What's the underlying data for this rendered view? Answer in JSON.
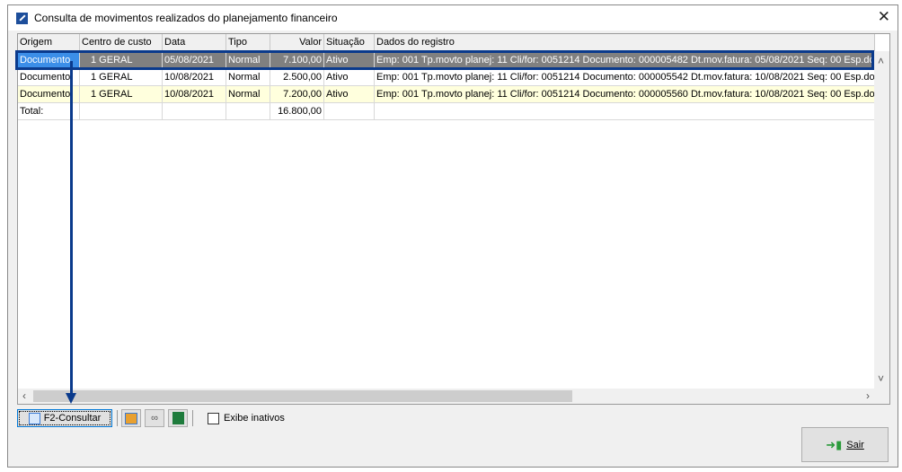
{
  "window": {
    "title": "Consulta de movimentos realizados do planejamento financeiro",
    "close": "✕"
  },
  "grid": {
    "columns": [
      "Origem",
      "Centro de custo",
      "Data",
      "Tipo",
      "Valor",
      "Situação",
      "Dados do registro"
    ],
    "rows": [
      [
        "Documento",
        "1 GERAL",
        "05/08/2021",
        "Normal",
        "7.100,00",
        "Ativo",
        "Emp: 001 Tp.movto planej: 11 Cli/for: 0051214 Documento: 000005482 Dt.mov.fatura: 05/08/2021 Seq: 00 Esp.do"
      ],
      [
        "Documento",
        "1 GERAL",
        "10/08/2021",
        "Normal",
        "2.500,00",
        "Ativo",
        "Emp: 001 Tp.movto planej: 11 Cli/for: 0051214 Documento: 000005542 Dt.mov.fatura: 10/08/2021 Seq: 00 Esp.do"
      ],
      [
        "Documento",
        "1 GERAL",
        "10/08/2021",
        "Normal",
        "7.200,00",
        "Ativo",
        "Emp: 001 Tp.movto planej: 11 Cli/for: 0051214 Documento: 000005560 Dt.mov.fatura: 10/08/2021 Seq: 00 Esp.do"
      ]
    ],
    "total_label": "Total:",
    "total_value": "16.800,00",
    "selected_row": 0
  },
  "toolbar": {
    "consultar": "F2-Consultar",
    "exibe_inativos": "Exibe inativos",
    "exibe_inativos_checked": false
  },
  "footer": {
    "sair": "Sair"
  },
  "colors": {
    "selection": "#808080",
    "annotation": "#0a3a8c",
    "alt_row": "#ffffdd"
  }
}
